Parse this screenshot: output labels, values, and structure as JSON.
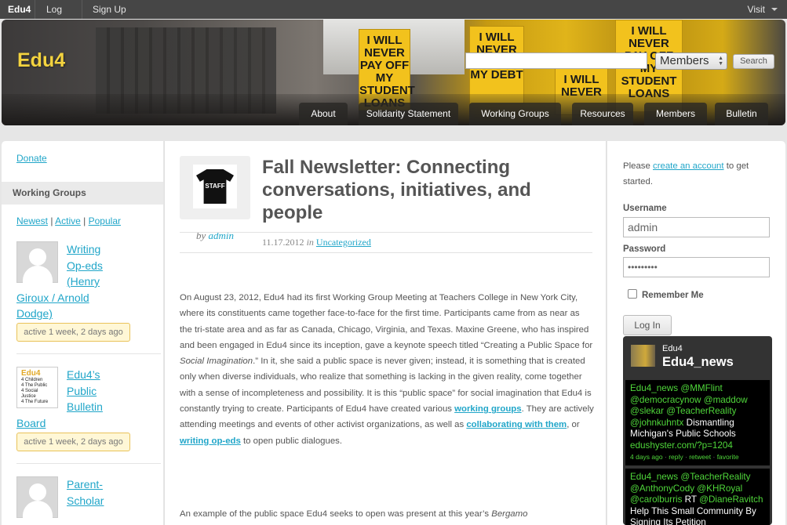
{
  "adminbar": {
    "brand": "Edu4",
    "login": "Log In",
    "signup": "Sign Up",
    "visit": "Visit"
  },
  "header": {
    "site_title": "Edu4",
    "search": {
      "value": "",
      "scope": "Members",
      "button": "Search"
    },
    "signs": [
      "I WILL NEVER PAY OFF MY STUDENT LOANS",
      "I WILL NEVER PAY OFF MY DEBT",
      "I WILL NEVER",
      "I WILL NEVER PAY OFF MY STUDENT LOANS"
    ],
    "nav": [
      "About",
      "Solidarity Statement",
      "Working Groups",
      "Resources",
      "Members",
      "Bulletin"
    ]
  },
  "left": {
    "donate": "Donate",
    "working_groups_heading": "Working Groups",
    "filters": [
      "Newest",
      "Active",
      "Popular"
    ],
    "groups": [
      {
        "title_l1": "Writing",
        "title_l2": "Op-eds",
        "title_l3": "(Henry",
        "title_l4": "Giroux / Arnold",
        "title_l5": "Dodge)",
        "activity": "active 1 week, 2 days ago"
      },
      {
        "title_l1": "Edu4’s",
        "title_l2": "Public",
        "title_l3": "Bulletin",
        "title_l4": "Board",
        "activity": "active 1 week, 2 days ago",
        "logo_lines": [
          "Edu4",
          "4 Children",
          "4 The Public",
          "4 Social Justice",
          "4 The Future"
        ]
      },
      {
        "title_l1": "Parent-",
        "title_l2": "Scholar"
      }
    ]
  },
  "post": {
    "author_badge": "STAFF",
    "by": "by",
    "author": "admin",
    "title": "Fall Newsletter: Connecting conversations, initiatives, and people",
    "date": "11.17.2012",
    "in": "in",
    "category": "Uncategorized",
    "p1_a": "On August 23, 2012, Edu4 had its first Working Group Meeting at Teachers College in New York City, where its constituents came together face-to-face for the first time. Participants came from as near as the tri-state area and as far as Canada, Chicago, Virginia, and Texas. Maxine Greene, who has inspired and been engaged in Edu4 since its inception, gave a keynote speech titled “Creating a Public Space for ",
    "p1_em": "Social Imagination",
    "p1_b": ".” In it, she said a public space is never given; instead, it is something that is created only when diverse individuals, who realize that something is lacking in the given reality, come together with a sense of incompleteness and possibility. It is this “public space” for social imagination that Edu4 is constantly trying to create. Participants of Edu4 have created various ",
    "link1": "working groups",
    "p1_c": ". They are actively attending meetings and events of other activist organizations, as well as ",
    "link2": "collaborating with them",
    "p1_d": ", or ",
    "link3": "writing op-eds",
    "p1_e": " to open public dialogues.",
    "p2_a": "An example of the public space Edu4 seeks to open was present at this year’s ",
    "p2_em": "Bergamo"
  },
  "right": {
    "intro_a": "Please ",
    "intro_link": "create an account",
    "intro_b": " to get started.",
    "username_label": "Username",
    "username_value": "admin",
    "password_label": "Password",
    "password_value": "•••••••••",
    "remember": "Remember Me",
    "login_button": "Log In",
    "twitter": {
      "user": "Edu4",
      "name": "Edu4_news",
      "tweets": [
        {
          "handles": "Edu4_news @MMFlint @democracynow @maddow @slekar @TeacherReality @johnkuhntx",
          "text": " Dismantling Michigan's Public Schools",
          "link": "edushyster.com/?p=1204",
          "time": "4 days ago",
          "actions": [
            "reply",
            "retweet",
            "favorite"
          ]
        },
        {
          "handles": "Edu4_news @TeacherReality @AnthonyCody @KHRoyal @carolburris",
          "rt": " RT ",
          "handle2": "@DianeRavitch",
          "text": " Help This Small Community By Signing Its Petition"
        }
      ]
    }
  }
}
